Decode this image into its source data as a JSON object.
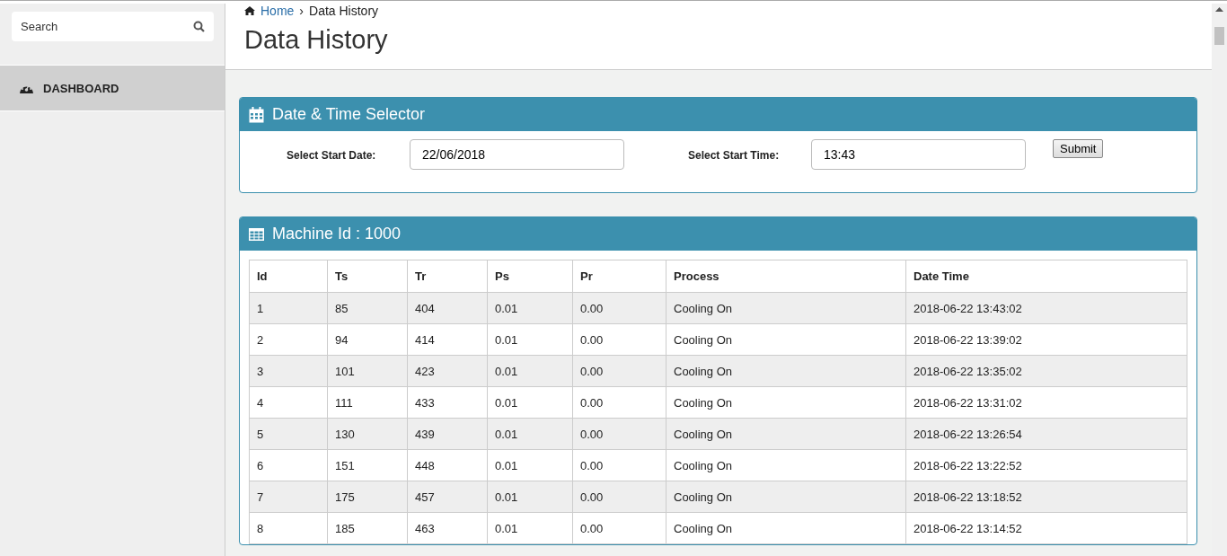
{
  "sidebar": {
    "search": {
      "placeholder": "Search"
    },
    "items": [
      {
        "label": "DASHBOARD",
        "selected": true
      }
    ]
  },
  "breadcrumb": {
    "home": "Home",
    "separator": "›",
    "current": "Data History"
  },
  "page_title": "Data History",
  "selector_panel": {
    "title": "Date & Time Selector",
    "date_label": "Select Start Date:",
    "date_value": "22/06/2018",
    "time_label": "Select Start Time:",
    "time_value": "13:43",
    "submit": "Submit"
  },
  "table_panel": {
    "title": "Machine Id : 1000",
    "columns": [
      "Id",
      "Ts",
      "Tr",
      "Ps",
      "Pr",
      "Process",
      "Date Time"
    ],
    "rows": [
      [
        "1",
        "85",
        "404",
        "0.01",
        "0.00",
        "Cooling On",
        "2018-06-22 13:43:02"
      ],
      [
        "2",
        "94",
        "414",
        "0.01",
        "0.00",
        "Cooling On",
        "2018-06-22 13:39:02"
      ],
      [
        "3",
        "101",
        "423",
        "0.01",
        "0.00",
        "Cooling On",
        "2018-06-22 13:35:02"
      ],
      [
        "4",
        "111",
        "433",
        "0.01",
        "0.00",
        "Cooling On",
        "2018-06-22 13:31:02"
      ],
      [
        "5",
        "130",
        "439",
        "0.01",
        "0.00",
        "Cooling On",
        "2018-06-22 13:26:54"
      ],
      [
        "6",
        "151",
        "448",
        "0.01",
        "0.00",
        "Cooling On",
        "2018-06-22 13:22:52"
      ],
      [
        "7",
        "175",
        "457",
        "0.01",
        "0.00",
        "Cooling On",
        "2018-06-22 13:18:52"
      ],
      [
        "8",
        "185",
        "463",
        "0.01",
        "0.00",
        "Cooling On",
        "2018-06-22 13:14:52"
      ]
    ]
  }
}
